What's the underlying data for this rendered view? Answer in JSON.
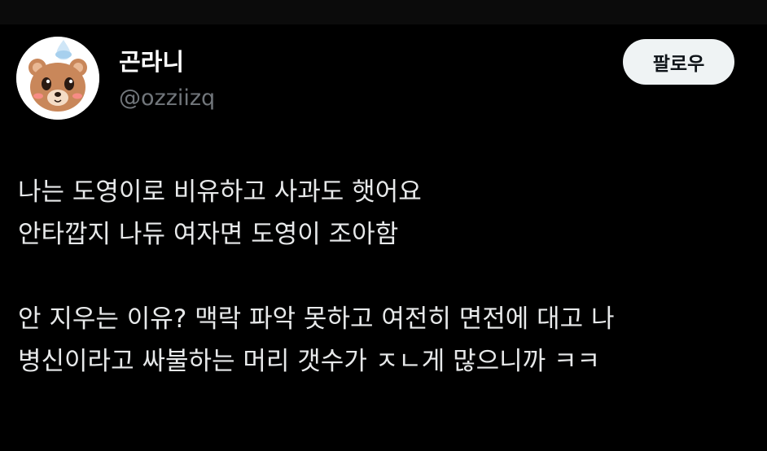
{
  "user": {
    "display_name": "곤라니",
    "handle": "@ozziizq",
    "avatar_icon": "bear-avatar-icon"
  },
  "actions": {
    "follow_label": "팔로우"
  },
  "tweet": {
    "lines": [
      "나는 도영이로 비유하고 사과도 햇어요",
      "안타깝지 나듀 여자면 도영이 조아함",
      "",
      "안 지우는 이유? 맥락 파악 못하고 여전히 면전에 대고 나",
      "병신이라고 싸불하는 머리 갯수가 ㅈㄴ게 많으니까 ㅋㅋ"
    ]
  },
  "colors": {
    "background": "#000000",
    "text": "#e7e9ea",
    "secondary_text": "#71767b",
    "button_bg": "#eff3f4"
  }
}
